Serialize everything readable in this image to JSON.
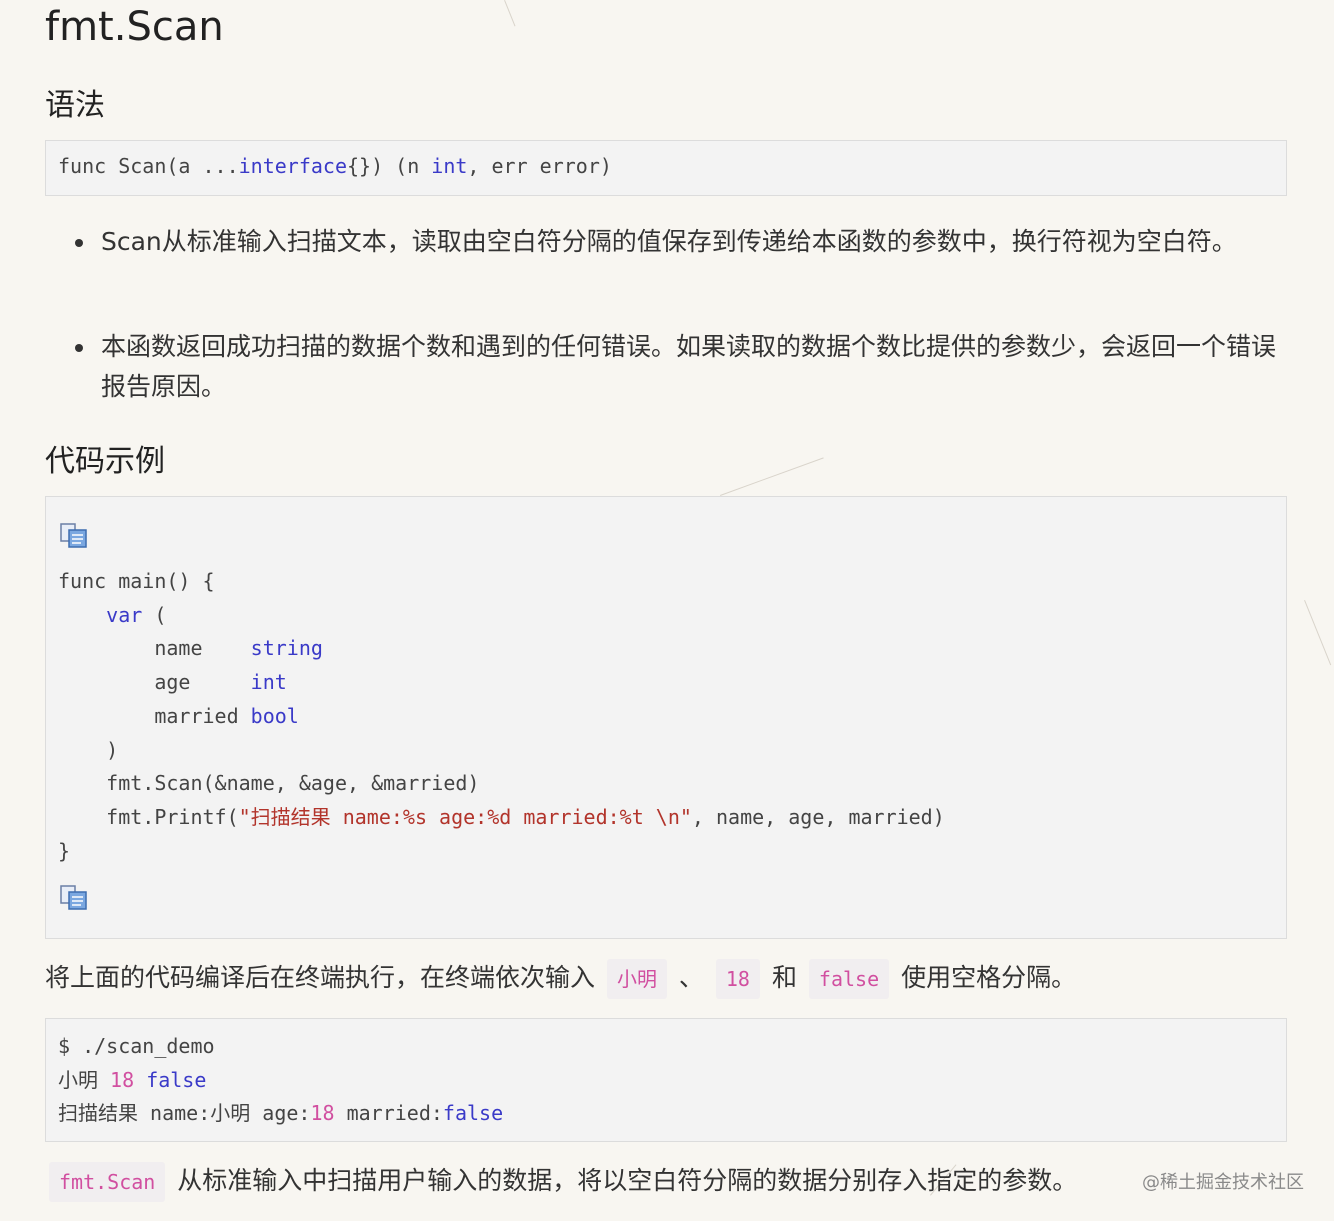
{
  "title": "fmt.Scan",
  "syntax": {
    "heading": "语法",
    "signature": {
      "prefix": "func Scan(a ...",
      "kw1": "interface",
      "mid": "{}) (n ",
      "kw2": "int",
      "suffix": ", err error)"
    }
  },
  "bullets": [
    "Scan从标准输入扫描文本，读取由空白符分隔的值保存到传递给本函数的参数中，换行符视为空白符。",
    "本函数返回成功扫描的数据个数和遇到的任何错误。如果读取的数据个数比提供的参数少，会返回一个错误报告原因。"
  ],
  "example": {
    "heading": "代码示例",
    "lines": {
      "l1": "func main() {",
      "l2_kw": "var",
      "l2_rest": " (",
      "l3_name": "name    ",
      "l3_type": "string",
      "l4_name": "age     ",
      "l4_type": "int",
      "l5_name": "married ",
      "l5_type": "bool",
      "l6": ")",
      "l7": "fmt.Scan(&name, &age, &married)",
      "l8_pre": "fmt.Printf(",
      "l8_str": "\"扫描结果 name:%s age:%d married:%t \\n\"",
      "l8_post": ", name, age, married)",
      "l9": "}"
    }
  },
  "run_note": {
    "before": "将上面的代码编译后在终端执行，在终端依次输入",
    "v1": "小明",
    "sep": "、",
    "v2": "18",
    "and": "和",
    "v3": "false",
    "after": "使用空格分隔。"
  },
  "terminal": {
    "cmd": "$ ./scan_demo",
    "input_name": "小明 ",
    "input_age": "18",
    "input_flag": "false",
    "out_prefix": "扫描结果 name:小明 age:",
    "out_age": "18",
    "out_mid": " married:",
    "out_flag": "false"
  },
  "summary": {
    "code": "fmt.Scan",
    "text": "从标准输入中扫描用户输入的数据，将以空白符分隔的数据分别存入指定的参数。"
  },
  "watermark": "@稀土掘金技术社区"
}
